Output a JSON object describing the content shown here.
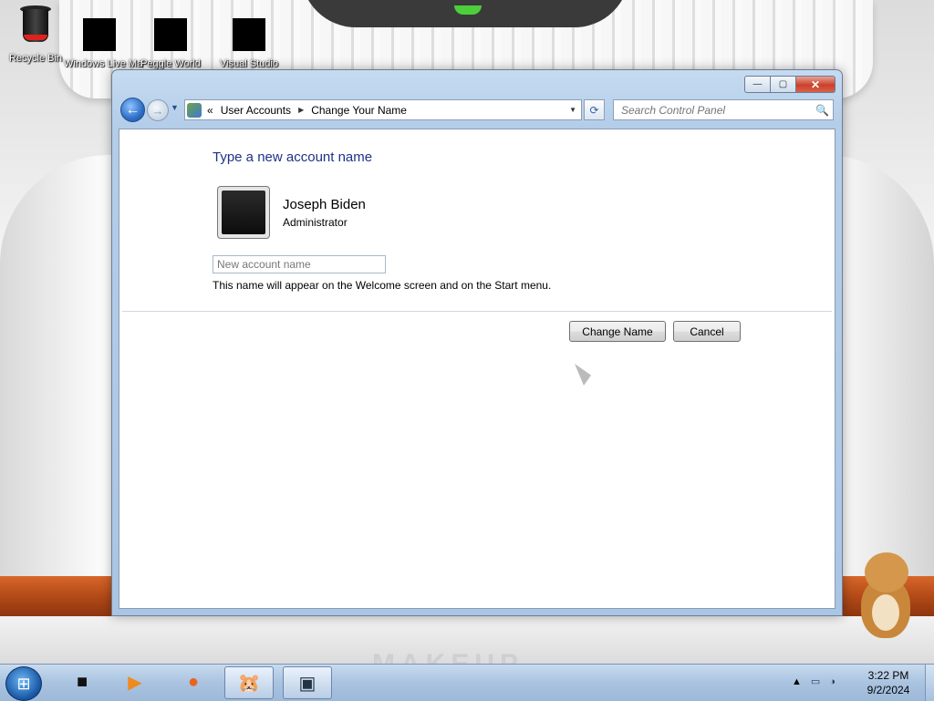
{
  "desktop": {
    "icons": [
      {
        "label": "Recycle Bin"
      },
      {
        "label": "Windows Live Ma"
      },
      {
        "label": "Peggle World"
      },
      {
        "label": "Visual Studio"
      }
    ],
    "wallpaper_text": "MAKEUP"
  },
  "window": {
    "caption_buttons": {
      "minimize": "—",
      "maximize": "▢",
      "close": "✕"
    },
    "nav": {
      "back_glyph": "←",
      "forward_glyph": "→",
      "dropdown_glyph": "▼",
      "refresh_glyph": "⟳"
    },
    "address": {
      "prefix": "«",
      "crumbs": [
        "User Accounts",
        "Change Your Name"
      ],
      "separator": "▶",
      "dropdown": "▼"
    },
    "search": {
      "placeholder": "Search Control Panel",
      "icon": "🔍"
    },
    "page_title": "Type a new account name",
    "account": {
      "name": "Joseph Biden",
      "role": "Administrator"
    },
    "new_name_field": {
      "value": "",
      "placeholder": "New account name"
    },
    "hint": "This name will appear on the Welcome screen and on the Start menu.",
    "buttons": {
      "change_name": "Change Name",
      "cancel": "Cancel"
    }
  },
  "taskbar": {
    "start_glyph": "⊞",
    "items": [
      {
        "name": "dark-app",
        "glyph": "■"
      },
      {
        "name": "media-player",
        "glyph": "▶"
      },
      {
        "name": "firefox",
        "glyph": "●"
      },
      {
        "name": "hamster-app",
        "glyph": "🐹"
      },
      {
        "name": "control-panel",
        "glyph": "▣"
      }
    ],
    "tray": {
      "chevron": "▲",
      "network": "▭",
      "volume": "◑"
    },
    "clock": {
      "time": "3:22 PM",
      "date": "9/2/2024"
    }
  },
  "colors": {
    "title_blue": "#1e3287",
    "window_frame": "#b4cde9",
    "taskbar": "#a9c3e0",
    "close_red": "#c9412b"
  }
}
